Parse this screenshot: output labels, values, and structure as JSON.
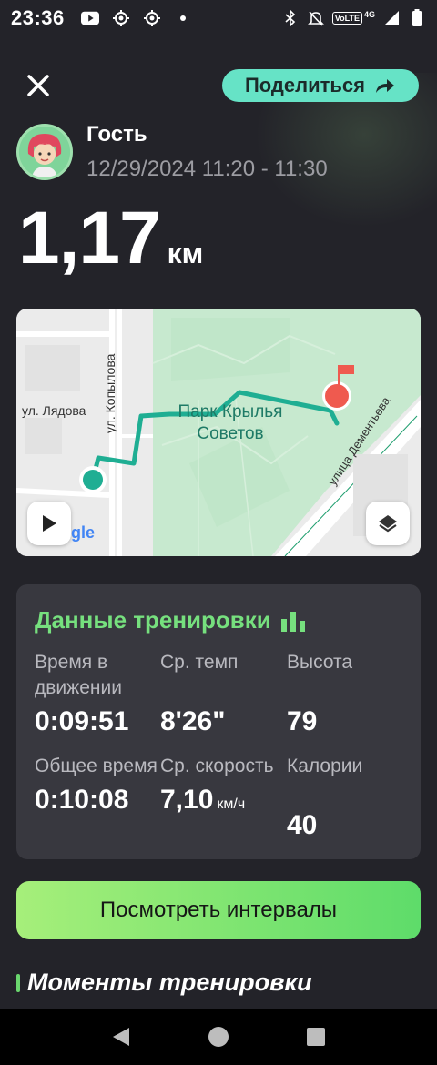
{
  "status_bar": {
    "time": "23:36",
    "volte": "VoLTE",
    "network": "4G"
  },
  "header": {
    "share_label": "Поделиться",
    "user_name": "Гость",
    "session_date": "12/29/2024 11:20 - 11:30",
    "distance_value": "1,17",
    "distance_unit": "км"
  },
  "map": {
    "street_left": "ул. Лядова",
    "street_vertical": "ул. Копылова",
    "park_name": "Парк Крылья Советов",
    "street_diagonal": "улица Дементьева",
    "google_logo_text": "gle"
  },
  "workout_data": {
    "title": "Данные тренировки",
    "stats": [
      {
        "label": "Время в движении",
        "value": "0:09:51",
        "unit": ""
      },
      {
        "label": "Ср. темп",
        "value": "8'26\"",
        "unit": ""
      },
      {
        "label": "Высота",
        "value": "79",
        "unit": ""
      },
      {
        "label": "Общее время",
        "value": "0:10:08",
        "unit": ""
      },
      {
        "label": "Ср. скорость",
        "value": "7,10",
        "unit": "км/ч"
      },
      {
        "label": "Калории",
        "value": "40",
        "unit": ""
      }
    ]
  },
  "intervals_button": "Посмотреть интервалы",
  "moments_title": "Моменты тренировки",
  "colors": {
    "background": "#232329",
    "accent_green": "#76e07e",
    "share_button": "#66e3c6",
    "route": "#1fae93"
  }
}
